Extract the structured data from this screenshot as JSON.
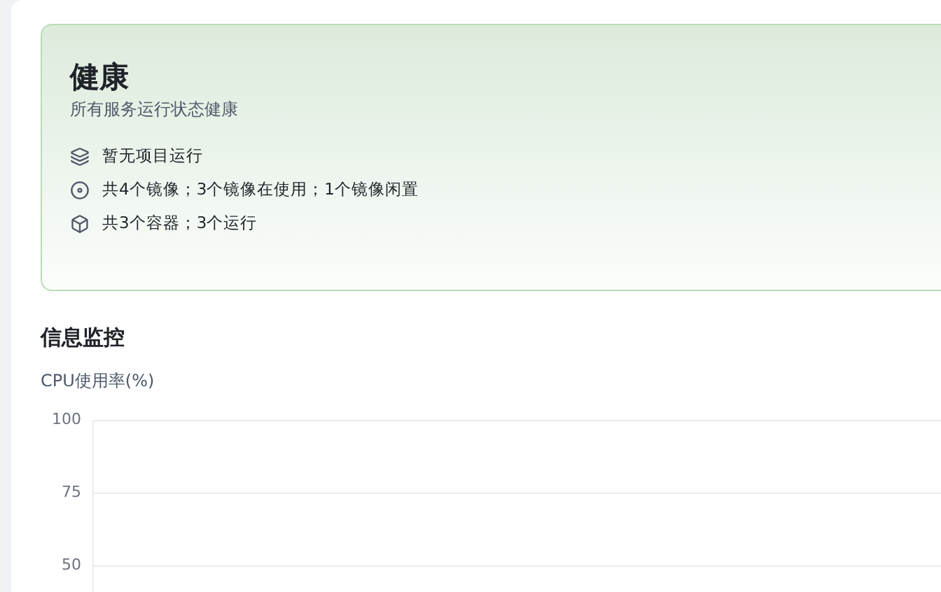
{
  "status_card": {
    "title": "健康",
    "subtitle": "所有服务运行状态健康",
    "items": [
      {
        "kind": "projects",
        "text": "暂无项目运行"
      },
      {
        "kind": "images",
        "text": "共4个镜像；3个镜像在使用；1个镜像闲置"
      },
      {
        "kind": "containers",
        "text": "共3个容器；3个运行"
      }
    ]
  },
  "monitor": {
    "title": "信息监控",
    "chart_title": "CPU使用率(%)",
    "y_axis_labels": [
      "100",
      "75",
      "50"
    ]
  }
}
